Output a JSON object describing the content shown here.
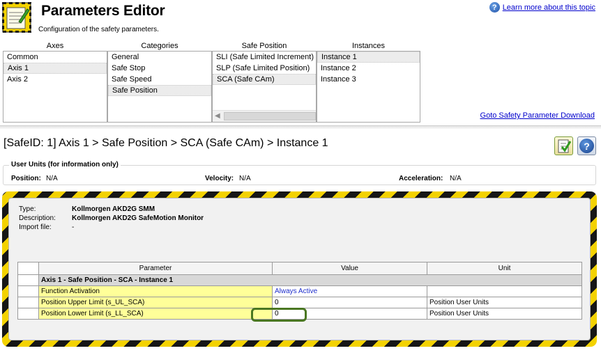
{
  "header": {
    "title": "Parameters Editor",
    "subtitle": "Configuration of the safety parameters.",
    "learn_more": "Learn more about this topic",
    "help_glyph": "?"
  },
  "columns": {
    "axes": {
      "label": "Axes",
      "items": [
        "Common",
        "Axis 1",
        "Axis 2"
      ],
      "selected": 1
    },
    "categories": {
      "label": "Categories",
      "items": [
        "General",
        "Safe Stop",
        "Safe Speed",
        "Safe Position"
      ],
      "selected": 3
    },
    "safe_position": {
      "label": "Safe Position",
      "items": [
        "SLI (Safe Limited Increment)",
        "SLP (Safe Limited Position)",
        "SCA (Safe CAm)"
      ],
      "selected": 2
    },
    "instances": {
      "label": "Instances",
      "items": [
        "Instance 1",
        "Instance 2",
        "Instance 3"
      ],
      "selected": 0
    }
  },
  "goto_link": "Goto Safety Parameter Download",
  "breadcrumb": "[SafeID: 1]  Axis 1 > Safe Position > SCA (Safe CAm) > Instance 1",
  "user_units": {
    "legend": "User Units (for information only)",
    "position_label": "Position:",
    "position_value": "N/A",
    "velocity_label": "Velocity:",
    "velocity_value": "N/A",
    "acceleration_label": "Acceleration:",
    "acceleration_value": "N/A"
  },
  "device": {
    "type_label": "Type:",
    "type_value": "Kollmorgen AKD2G SMM",
    "description_label": "Description:",
    "description_value": "Kollmorgen AKD2G SafeMotion Monitor",
    "import_label": "Import file:",
    "import_value": "-"
  },
  "table": {
    "headers": {
      "parameter": "Parameter",
      "value": "Value",
      "unit": "Unit"
    },
    "group": "Axis 1 - Safe Position - SCA - Instance 1",
    "rows": [
      {
        "parameter": "Function Activation",
        "value": "Always Active",
        "unit": ""
      },
      {
        "parameter": "Position Upper Limit (s_UL_SCA)",
        "value": "0",
        "unit": "Position User Units"
      },
      {
        "parameter": "Position Lower Limit (s_LL_SCA)",
        "value": "0",
        "unit": "Position User Units"
      }
    ]
  },
  "colors": {
    "hazard_yellow": "#f3d200",
    "hazard_black": "#161616",
    "param_highlight": "#ffff99",
    "focus_ring": "#4a7722",
    "link": "#0000cc"
  },
  "icons": [
    "editor-notepad-icon",
    "help-icon",
    "checklist-icon",
    "scroll-left-icon"
  ]
}
